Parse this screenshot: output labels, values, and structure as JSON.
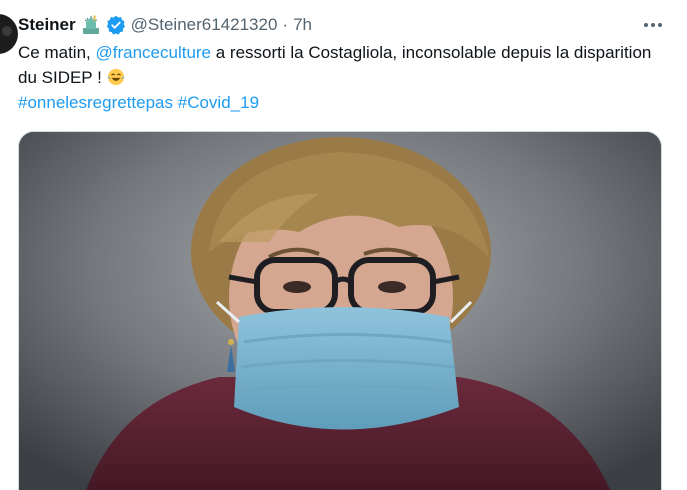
{
  "tweet": {
    "display_name": "Steiner",
    "handle": "@Steiner61421320",
    "separator": "·",
    "time": "7h",
    "text_part1": "Ce matin, ",
    "mention": "@franceculture",
    "text_part2": " a ressorti la Costagliola, inconsolable depuis la disparition du SIDEP ! ",
    "hashtags": [
      "#onnelesregrettepas",
      "#Covid_19"
    ],
    "emoji": "face-with-tears-of-joy",
    "name_emoji": "statue-of-liberty"
  },
  "colors": {
    "link": "#1d9bf0",
    "verified": "#1d9bf0",
    "secondary_text": "#536471",
    "mask": "#7fb3cf"
  },
  "icons": {
    "more": "more-dots-icon",
    "verified": "verified-badge-icon"
  }
}
